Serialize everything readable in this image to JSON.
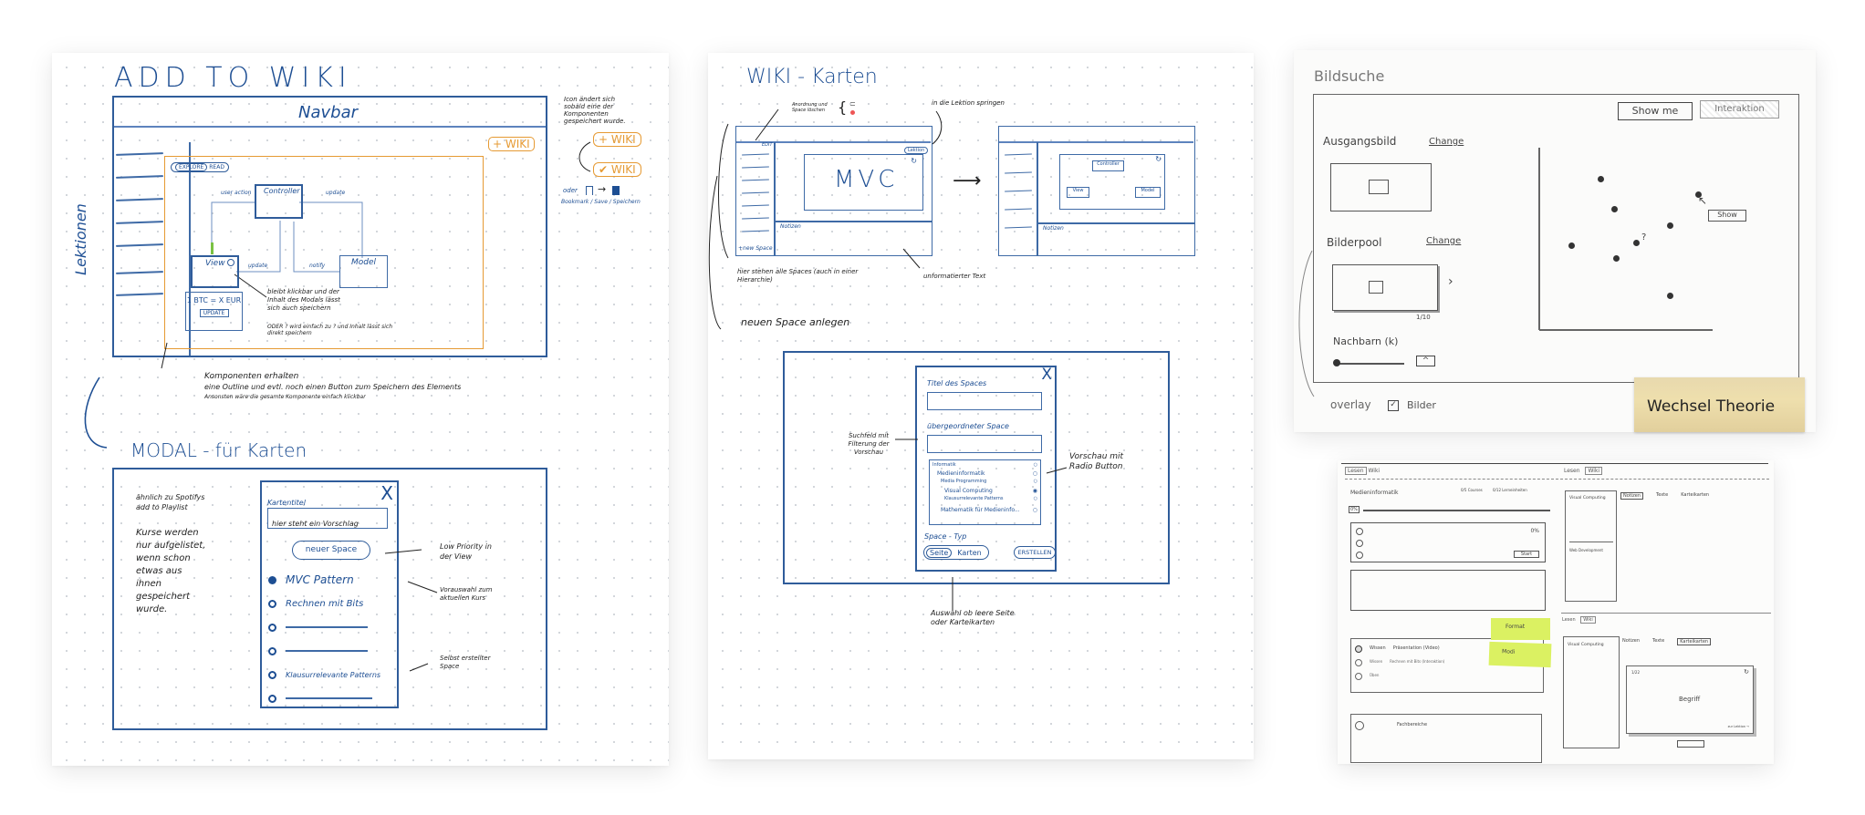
{
  "panel1": {
    "title": "ADD TO WIKI",
    "navbar": "Navbar",
    "sidebar_label": "Lektionen",
    "wiki_button": "+ WIKI",
    "toggle": {
      "explore": "EXPLORE",
      "read": "READ"
    },
    "mvc": {
      "controller": "Controller",
      "view": "View",
      "model": "Model",
      "edge_user_action": "user action",
      "edge_update_top": "update",
      "edge_update_view": "update",
      "edge_notify": "notify",
      "info_icon": "?"
    },
    "widget": {
      "text": "1 BTC = X EUR",
      "button": "UPDATE"
    },
    "annotation_view": "bleibt klickbar und der Inhalt des Modals lässt sich auch speichern",
    "annotation_oder": "ODER ? wird einfach zu ? und Inhalt lässt sich direkt speichern",
    "annotation_components_line1": "Komponenten erhalten",
    "annotation_components_line2": "eine Outline und evtl. noch einen Button zum Speichern des Elements",
    "annotation_components_line3": "Ansonsten wäre die gesamte Komponente einfach klickbar",
    "side_note": "Icon ändert sich sobald eine der Komponenten gespeichert wurde.",
    "side_btn_add": "+ WIKI",
    "side_btn_saved": "✔ WIKI",
    "side_or": "oder",
    "side_bookmark_caption": "Bookmark / Save / Speichern",
    "modal_title": "MODAL - für Karten",
    "modal_note1": "ähnlich zu Spotifys add to Playlist",
    "modal_note2": "Kurse werden nur aufgelistet, wenn schon etwas aus ihnen gespeichert wurde.",
    "modal": {
      "close": "X",
      "field_label": "Kartentitel",
      "field_value": "hier steht ein Vorschlag",
      "new_space": "neuer Space",
      "options": [
        {
          "label": "MVC Pattern",
          "selected": true
        },
        {
          "label": "Rechnen mit Bits",
          "selected": false
        },
        {
          "label": "",
          "selected": false
        },
        {
          "label": "",
          "selected": false
        },
        {
          "label": "Klausurrelevante Patterns",
          "selected": false
        },
        {
          "label": "",
          "selected": false
        }
      ]
    },
    "anno_low_priority": "Low Priority in der View",
    "anno_preselect": "Vorauswahl zum aktuellen Kurs",
    "anno_own_space": "Selbst erstellter Space"
  },
  "panel2": {
    "title": "WIKI - Karten",
    "anno_order": "Anordnung und Space löschen",
    "anno_jump": "in die Lektion springen",
    "edit": "EDIT",
    "lektion_button": "Lektion",
    "card_text": "MVC",
    "notes_label": "Notizen",
    "new_space": "+new Space",
    "anno_spaces": "hier stehen alle Spaces (auch in einer Hierarchie)",
    "anno_unformatted": "unformatierter Text",
    "anno_create": "neuen Space anlegen",
    "card2": {
      "controller": "Controller",
      "view": "View",
      "model": "Model"
    },
    "notes_label2": "Notizen",
    "dialog": {
      "close": "X",
      "title_label": "Titel des Spaces",
      "parent_label": "übergeordneter Space",
      "tree": [
        {
          "label": "Informatik",
          "level": 0,
          "selected": false
        },
        {
          "label": "Medieninformatik",
          "level": 1,
          "selected": false
        },
        {
          "label": "Media Programming",
          "level": 2,
          "selected": false
        },
        {
          "label": "Visual Computing",
          "level": 3,
          "selected": true
        },
        {
          "label": "Klausurrelevante Patterns",
          "level": 3,
          "selected": false
        },
        {
          "label": "Mathematik für Medieninfo...",
          "level": 2,
          "selected": false
        }
      ],
      "type_label": "Space - Typ",
      "type_options": [
        "Seite",
        "Karten"
      ],
      "create": "ERSTELLEN"
    },
    "anno_search": "Suchfeld mit Filterung der Vorschau",
    "anno_preview": "Vorschau mit Radio Button",
    "anno_choice": "Auswahl ob leere Seite oder Karteikarten"
  },
  "panel3": {
    "title": "Bildsuche",
    "show_me": "Show me",
    "interaction": "Interaktion",
    "start_image_label": "Ausgangsbild",
    "change1": "Change",
    "pool_label": "Bilderpool",
    "change2": "Change",
    "pool_count": "1/10",
    "neighbors_label": "Nachbarn (k)",
    "show_tag": "Show",
    "question": "?",
    "overlay": "overlay",
    "images_checkbox": "Bilder",
    "images_checked": true,
    "sticky": "Wechsel Theorie"
  },
  "panel4": {
    "nav_left": [
      "Lesen",
      "Wiki"
    ],
    "nav_right": [
      "Lesen",
      "Wiki"
    ],
    "course": "Medieninformatik",
    "stat1": "0/5 Courses",
    "stat2": "0/12 Lerneinheiten",
    "progress": "0%",
    "unit_progress": "0%",
    "start": "Start",
    "tree_top": "Visual Computing",
    "tree_bottom": "Web Development",
    "tabs": [
      "Notizen",
      "Texte",
      "Karteikarten"
    ],
    "active_tab_top": "Notizen",
    "steps": [
      {
        "type": "Wissen",
        "label": "Präsentation (Video)"
      },
      {
        "type": "Wissen",
        "label": "Rechnen mit Bits (Interaktion)"
      },
      {
        "type": "Üben",
        "label": ""
      }
    ],
    "sticky1": "Format",
    "sticky2": "Modi",
    "section": "Fachbereiche",
    "tree_top2": "Visual Computing",
    "active_tab_bottom": "Karteikarten",
    "card_counter": "1/22",
    "card_term": "Begriff",
    "card_link": "zur Lektion →",
    "nav_right2": [
      "Lesen",
      "Wiki"
    ]
  }
}
